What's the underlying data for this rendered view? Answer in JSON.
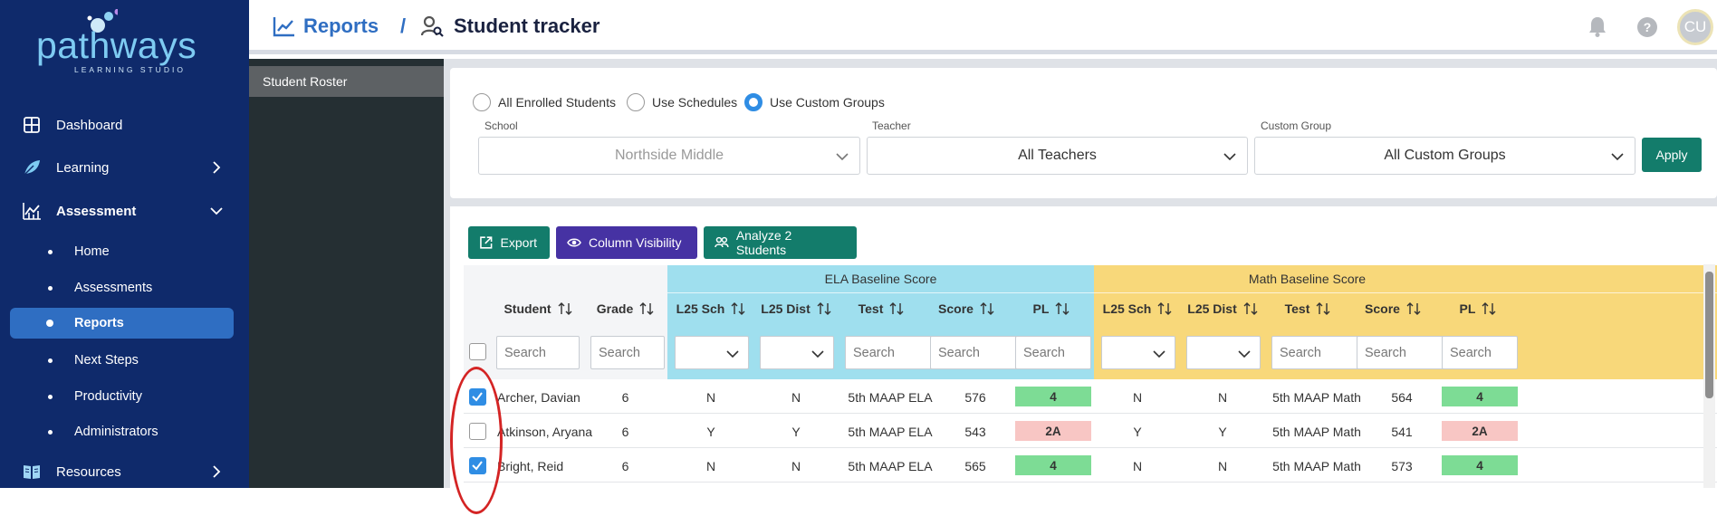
{
  "sidebar": {
    "logo_text": "pathways",
    "logo_subtext": "LEARNING STUDIO",
    "nav": [
      {
        "label": "Dashboard",
        "icon": "dashboard-grid-icon"
      },
      {
        "label": "Learning",
        "icon": "leaf-icon"
      },
      {
        "label": "Assessment",
        "icon": "chart-icon"
      },
      {
        "label": "Resources",
        "icon": "book-icon"
      }
    ],
    "assessment_sub": [
      {
        "label": "Home"
      },
      {
        "label": "Assessments"
      },
      {
        "label": "Reports",
        "active": true
      },
      {
        "label": "Next Steps"
      },
      {
        "label": "Productivity"
      },
      {
        "label": "Administrators"
      }
    ]
  },
  "header": {
    "breadcrumb_reports": "Reports",
    "breadcrumb_separator": "/",
    "breadcrumb_page": "Student tracker",
    "avatar_initials": "CU"
  },
  "subnav": {
    "item": "Student Roster"
  },
  "filters": {
    "radios": [
      {
        "label": "All Enrolled Students",
        "checked": false
      },
      {
        "label": "Use Schedules",
        "checked": false
      },
      {
        "label": "Use Custom Groups",
        "checked": true
      }
    ],
    "school_label": "School",
    "school_value": "Northside Middle",
    "teacher_label": "Teacher",
    "teacher_value": "All Teachers",
    "group_label": "Custom Group",
    "group_value": "All Custom Groups",
    "apply": "Apply"
  },
  "toolbar": {
    "export": "Export",
    "column_visibility": "Column Visibility",
    "analyze": "Analyze 2 Students"
  },
  "table": {
    "group_ela": "ELA Baseline Score",
    "group_math": "Math Baseline Score",
    "columns": {
      "student": "Student",
      "grade": "Grade",
      "ela_l25sch": "L25 Sch",
      "ela_l25dist": "L25 Dist",
      "ela_test": "Test",
      "ela_score": "Score",
      "ela_pl": "PL",
      "math_l25sch": "L25 Sch",
      "math_l25dist": "L25 Dist",
      "math_test": "Test",
      "math_score": "Score",
      "math_pl": "PL"
    },
    "search_placeholder": "Search",
    "rows": [
      {
        "checked": true,
        "student": "Archer, Davian",
        "grade": "6",
        "ela_l25sch": "N",
        "ela_l25dist": "N",
        "ela_test": "5th MAAP ELA",
        "ela_score": "576",
        "ela_pl": "4",
        "math_l25sch": "N",
        "math_l25dist": "N",
        "math_test": "5th MAAP Math",
        "math_score": "564",
        "math_pl": "4"
      },
      {
        "checked": false,
        "student": "Atkinson, Aryana",
        "grade": "6",
        "ela_l25sch": "Y",
        "ela_l25dist": "Y",
        "ela_test": "5th MAAP ELA",
        "ela_score": "543",
        "ela_pl": "2A",
        "math_l25sch": "Y",
        "math_l25dist": "Y",
        "math_test": "5th MAAP Math",
        "math_score": "541",
        "math_pl": "2A"
      },
      {
        "checked": true,
        "student": "Bright, Reid",
        "grade": "6",
        "ela_l25sch": "N",
        "ela_l25dist": "N",
        "ela_test": "5th MAAP ELA",
        "ela_score": "565",
        "ela_pl": "4",
        "math_l25sch": "N",
        "math_l25dist": "N",
        "math_test": "5th MAAP Math",
        "math_score": "573",
        "math_pl": "4"
      }
    ]
  },
  "colors": {
    "sidebar_bg": "#0f2a6b",
    "active_item": "#2f6ec2",
    "primary_teal": "#137c6b",
    "purple": "#4632a3",
    "ela_band": "#9fdfee",
    "math_band": "#f8d87a",
    "pl_good": "#7ddc95",
    "pl_bad": "#f8c6c4",
    "annotation_red": "#d42424"
  }
}
